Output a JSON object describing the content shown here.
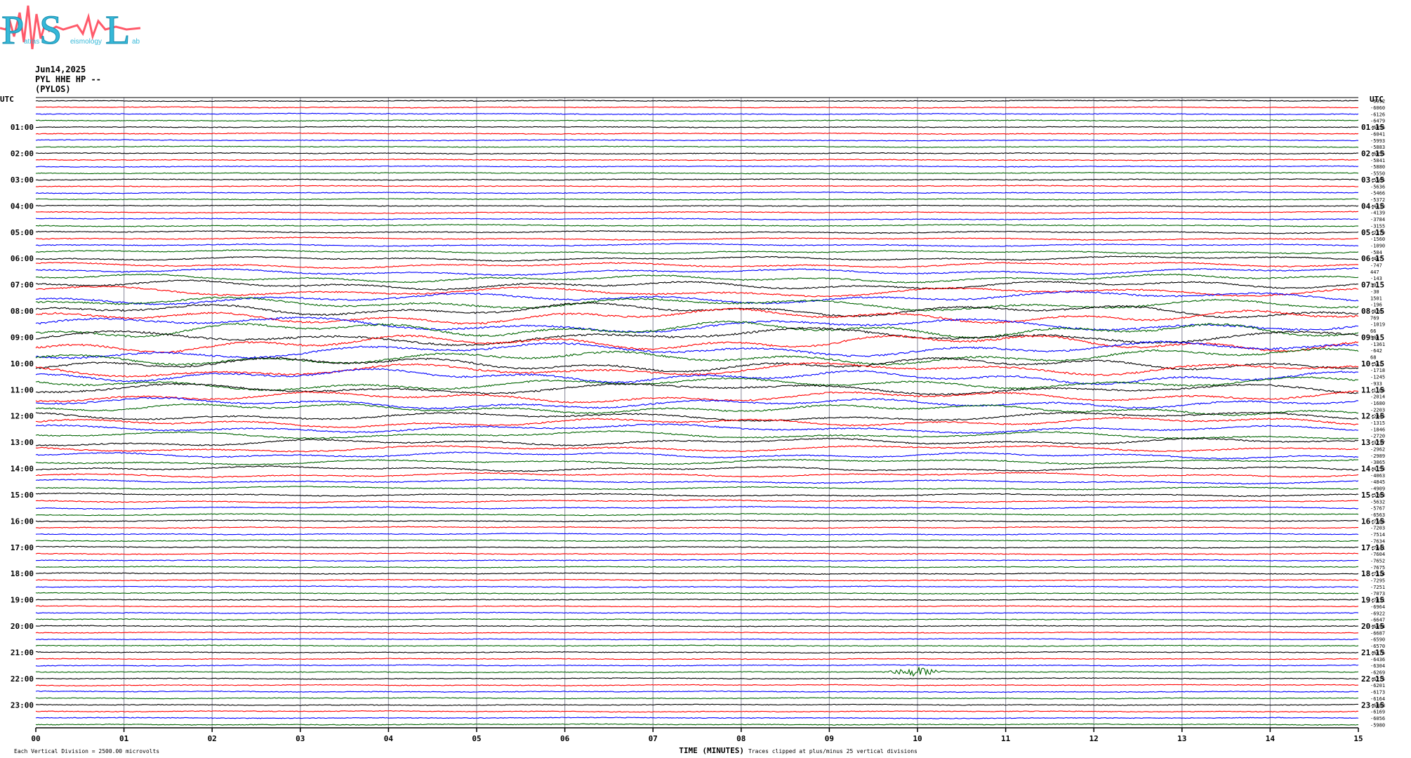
{
  "logo": {
    "letters": [
      "P",
      "S",
      "L"
    ],
    "words": [
      "atras",
      "eismology",
      "ab"
    ],
    "text_color": "#35b8d8",
    "wave_color": "#ff5a6a"
  },
  "header": {
    "date": "Jun14,2025",
    "channel": "PYL HHE HP --",
    "station": "(PYLOS)"
  },
  "chart_data": {
    "type": "line",
    "xlabel": "TIME (MINUTES)",
    "xlim": [
      0,
      15
    ],
    "x_ticks": [
      "00",
      "01",
      "02",
      "03",
      "04",
      "05",
      "06",
      "07",
      "08",
      "09",
      "10",
      "11",
      "12",
      "13",
      "14",
      "15"
    ],
    "left_axis_label": "UTC",
    "right_axis_label": "UTC",
    "left_hours": [
      "01:00",
      "02:00",
      "03:00",
      "04:00",
      "05:00",
      "06:00",
      "07:00",
      "08:00",
      "09:00",
      "10:00",
      "11:00",
      "12:00",
      "13:00",
      "14:00",
      "15:00",
      "16:00",
      "17:00",
      "18:00",
      "19:00",
      "20:00",
      "21:00",
      "22:00",
      "23:00"
    ],
    "right_hours": [
      "01:15",
      "02:15",
      "03:15",
      "04:15",
      "05:15",
      "06:15",
      "07:15",
      "08:15",
      "09:15",
      "10:15",
      "11:15",
      "12:15",
      "13:15",
      "14:15",
      "15:15",
      "16:15",
      "17:15",
      "18:15",
      "19:15",
      "20:15",
      "21:15",
      "22:15",
      "23:15"
    ],
    "trace_colors": [
      "#000000",
      "#ff0000",
      "#0000ff",
      "#006400"
    ],
    "trace_offsets": [
      "-6992",
      "-6060",
      "-6126",
      "-6479",
      "-6056",
      "-6041",
      "-5993",
      "-5883",
      "-6055",
      "-5841",
      "-5880",
      "-5550",
      "-5565",
      "-5636",
      "-5466",
      "-5372",
      "-4433",
      "-4139",
      "-3784",
      "-3155",
      "-2379",
      "-1560",
      "-1090",
      "-584",
      "-467",
      "-747",
      "447",
      "-143",
      "301",
      "-30",
      "1501",
      "-196",
      "-826",
      "769",
      "-1019",
      "66",
      "580",
      "-1361",
      "-642",
      "68",
      "-541",
      "-1718",
      "-1245",
      "-933",
      "-1106",
      "-2014",
      "-1680",
      "-2203",
      "-2045",
      "-1315",
      "-1846",
      "-2720",
      "-3237",
      "-2962",
      "-2989",
      "-3865",
      "-4153",
      "-4063",
      "-4845",
      "-4909",
      "-5203",
      "-5632",
      "-5767",
      "-6563",
      "-7506",
      "-7203",
      "-7514",
      "-7634",
      "-7641",
      "-7604",
      "-7652",
      "-7675",
      "-7514",
      "-7295",
      "-7251",
      "-7073",
      "-7031",
      "-6964",
      "-6922",
      "-6647",
      "-6694",
      "-6687",
      "-6590",
      "-6570",
      "-6476",
      "-6436",
      "-6304",
      "-6269",
      "-6215",
      "-6201",
      "-6173",
      "-6164",
      "-6088",
      "-6169",
      "-6056",
      "-5980"
    ],
    "amplitude_profile": [
      0.3,
      0.3,
      0.3,
      0.3,
      0.3,
      0.3,
      0.3,
      0.3,
      0.3,
      0.3,
      0.3,
      0.3,
      0.35,
      0.35,
      0.35,
      0.35,
      0.4,
      0.45,
      0.5,
      0.55,
      0.7,
      0.8,
      0.9,
      1.1,
      1.4,
      1.8,
      2.2,
      2.6,
      3,
      3.4,
      3.8,
      4.2,
      4.6,
      5,
      5.2,
      5.4,
      5.4,
      5.4,
      5.2,
      5,
      4.8,
      4.6,
      4.4,
      4.2,
      4,
      3.8,
      3.6,
      3.4,
      3.2,
      3,
      2.8,
      2.6,
      2.4,
      2.2,
      2,
      1.8,
      1.6,
      1.4,
      1.2,
      1,
      0.9,
      0.8,
      0.7,
      0.6,
      0.5,
      0.45,
      0.4,
      0.4,
      0.4,
      0.4,
      0.4,
      0.4,
      0.35,
      0.35,
      0.35,
      0.3,
      0.3,
      0.3,
      0.3,
      0.3,
      0.3,
      0.3,
      0.3,
      0.3,
      0.3,
      0.3,
      0.3,
      0.3,
      0.3,
      0.3,
      0.3,
      0.3,
      0.3,
      0.3,
      0.3,
      0.3
    ],
    "event": {
      "trace_index": 87,
      "start_min": 9.6,
      "end_min": 11.2,
      "color": "#ff0000"
    },
    "footer_left": "Each Vertical Division = 2500.00 microvolts",
    "footer_right": "Traces clipped at plus/minus 25 vertical divisions"
  }
}
